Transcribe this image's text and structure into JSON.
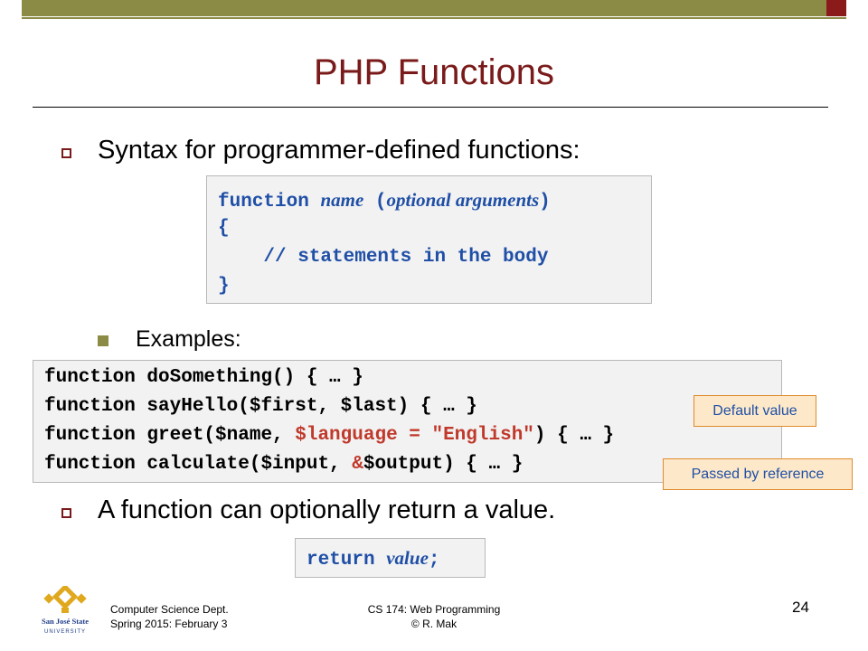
{
  "slide": {
    "title": "PHP Functions",
    "bullets": [
      {
        "text": "Syntax for programmer-defined functions:"
      },
      {
        "text": "A function can optionally return a value."
      }
    ],
    "sub_bullet": "Examples:",
    "syntax_code": {
      "keyword": "function",
      "name": "name",
      "open_paren": "(",
      "args": "optional arguments",
      "close_paren": ")",
      "open_brace": "{",
      "comment": "    // statements in the body",
      "close_brace": "}"
    },
    "examples_code": {
      "line1": "function doSomething() { … }",
      "line2": "function sayHello($first, $last) { … }",
      "line3_pre": "function greet($name, ",
      "line3_default": "$language = \"English\"",
      "line3_post": ") { … }",
      "line4_pre": "function calculate($input, ",
      "line4_ref": "&",
      "line4_post": "$output) { … }"
    },
    "return_code": {
      "keyword": "return",
      "value": "value",
      "semicolon": ";"
    },
    "callouts": {
      "default_value": "Default value",
      "by_reference": "Passed by reference"
    }
  },
  "footer": {
    "left_line1": "Computer Science Dept.",
    "left_line2": "Spring 2015: February 3",
    "center_line1": "CS 174: Web Programming",
    "center_line2": "© R. Mak",
    "page_number": "24",
    "logo_text_top": "San José State",
    "logo_text_bottom": "UNIVERSITY"
  },
  "colors": {
    "title": "#7a1a1a",
    "accent_bar": "#8b8b46",
    "code_blue": "#1f4fa6",
    "code_red": "#c0392b",
    "callout_fill": "#fde9c9",
    "callout_border": "#e08a2b"
  }
}
